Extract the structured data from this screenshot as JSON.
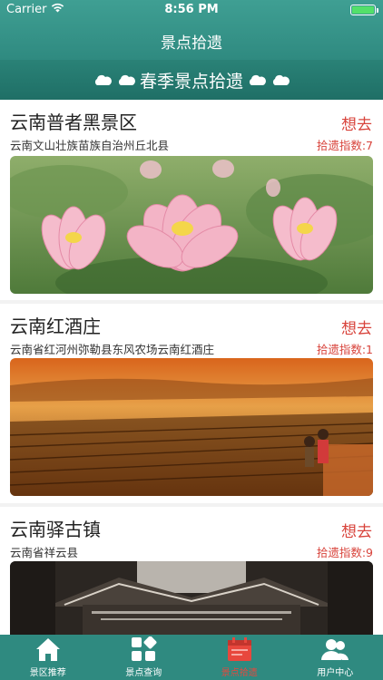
{
  "status_bar": {
    "carrier": "Carrier",
    "time": "8:56 PM"
  },
  "nav": {
    "title": "景点拾遗"
  },
  "banner": {
    "title": "春季景点拾遗"
  },
  "cards": [
    {
      "title": "云南普者黑景区",
      "address": "云南文山壮族苗族自治州丘北县",
      "want": "想去",
      "index": "拾遗指数:7",
      "image": "lotus-photo"
    },
    {
      "title": "云南红酒庄",
      "address": "云南省红河州弥勒县东风农场云南红酒庄",
      "want": "想去",
      "index": "拾遗指数:1",
      "image": "vineyard-photo"
    },
    {
      "title": "云南驿古镇",
      "address": "云南省祥云县",
      "want": "想去",
      "index": "拾遗指数:9",
      "image": "old-town-photo"
    }
  ],
  "tabs": [
    {
      "label": "景区推荐",
      "icon": "home-icon"
    },
    {
      "label": "景点查询",
      "icon": "grid-icon"
    },
    {
      "label": "景点拾遗",
      "icon": "calendar-icon"
    },
    {
      "label": "用户中心",
      "icon": "users-icon"
    }
  ],
  "colors": {
    "teal": "#2f8a80",
    "accent_red": "#d8433b",
    "active_tab": "#e8473d"
  }
}
